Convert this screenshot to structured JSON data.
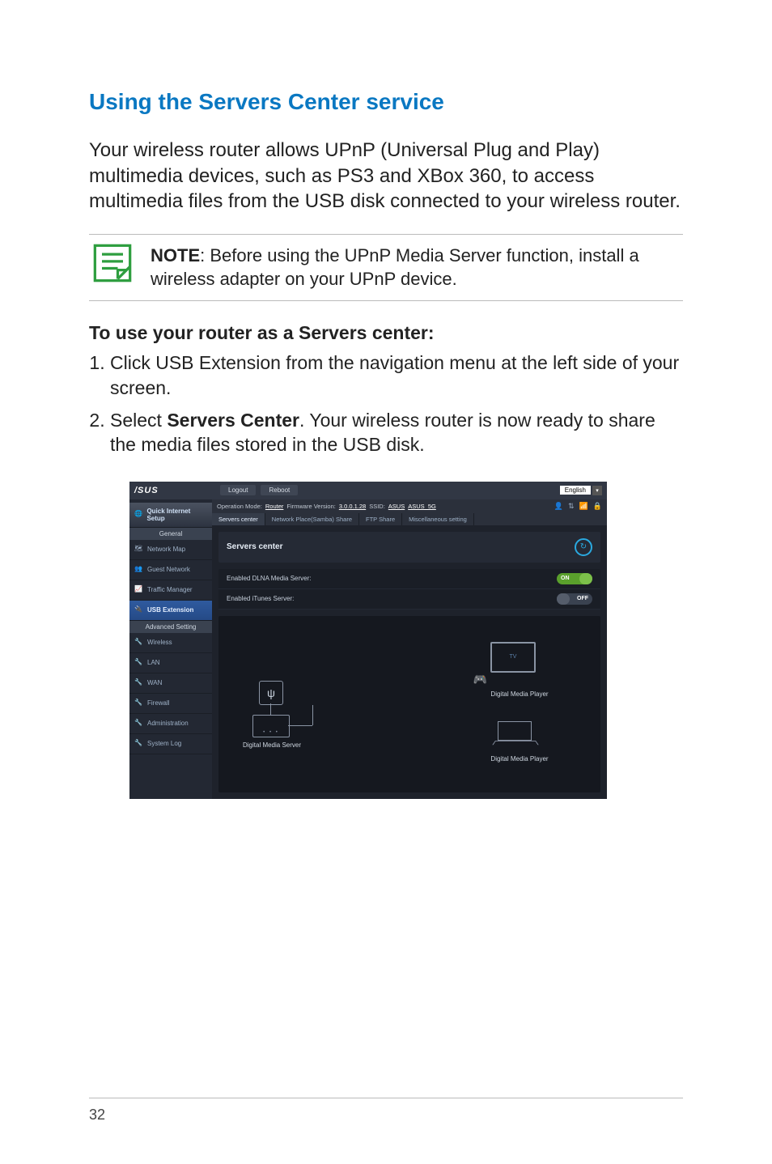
{
  "page_number": "32",
  "title": "Using the Servers Center service",
  "intro": "Your wireless router allows UPnP (Universal Plug and Play) multimedia devices, such as PS3 and XBox 360, to access multimedia files from the USB disk connected to your wireless router.",
  "note": {
    "label": "NOTE",
    "text": ": Before using the UPnP Media Server function, install a wireless adapter on your UPnP device."
  },
  "sub_heading": "To use your router as a Servers center:",
  "steps": {
    "s1": "Click USB Extension from the navigation menu at the left side of your screen.",
    "s2_pre": "Select ",
    "s2_bold": "Servers Center",
    "s2_post": ". Your wireless router is now ready to share the media files stored in the USB disk."
  },
  "router": {
    "brand": "/SUS",
    "top_buttons": {
      "logout": "Logout",
      "reboot": "Reboot"
    },
    "language": "English",
    "status": {
      "op_mode_label": "Operation Mode:",
      "op_mode_value": "Router",
      "fw_label": "Firmware Version:",
      "fw_value": "3.0.0.1.28",
      "ssid_label": "SSID:",
      "ssid1": "ASUS",
      "ssid2": "ASUS_5G"
    },
    "tabs": {
      "t1": "Servers center",
      "t2": "Network Place(Samba) Share",
      "t3": "FTP Share",
      "t4": "Miscellaneous setting"
    },
    "panel_title": "Servers center",
    "rows": {
      "dlna": {
        "label": "Enabled DLNA Media Server:",
        "state": "ON"
      },
      "itunes": {
        "label": "Enabled iTunes Server:",
        "state": "OFF"
      }
    },
    "sidebar": {
      "qis": "Quick Internet Setup",
      "general": "General",
      "network_map": "Network Map",
      "guest": "Guest Network",
      "traffic": "Traffic Manager",
      "usb": "USB Extension",
      "advanced": "Advanced Setting",
      "wireless": "Wireless",
      "lan": "LAN",
      "wan": "WAN",
      "firewall": "Firewall",
      "admin": "Administration",
      "syslog": "System Log"
    },
    "diagram": {
      "dms": "Digital Media Server",
      "tv": "TV",
      "dmp1": "Digital Media Player",
      "dmp2": "Digital Media Player"
    }
  }
}
